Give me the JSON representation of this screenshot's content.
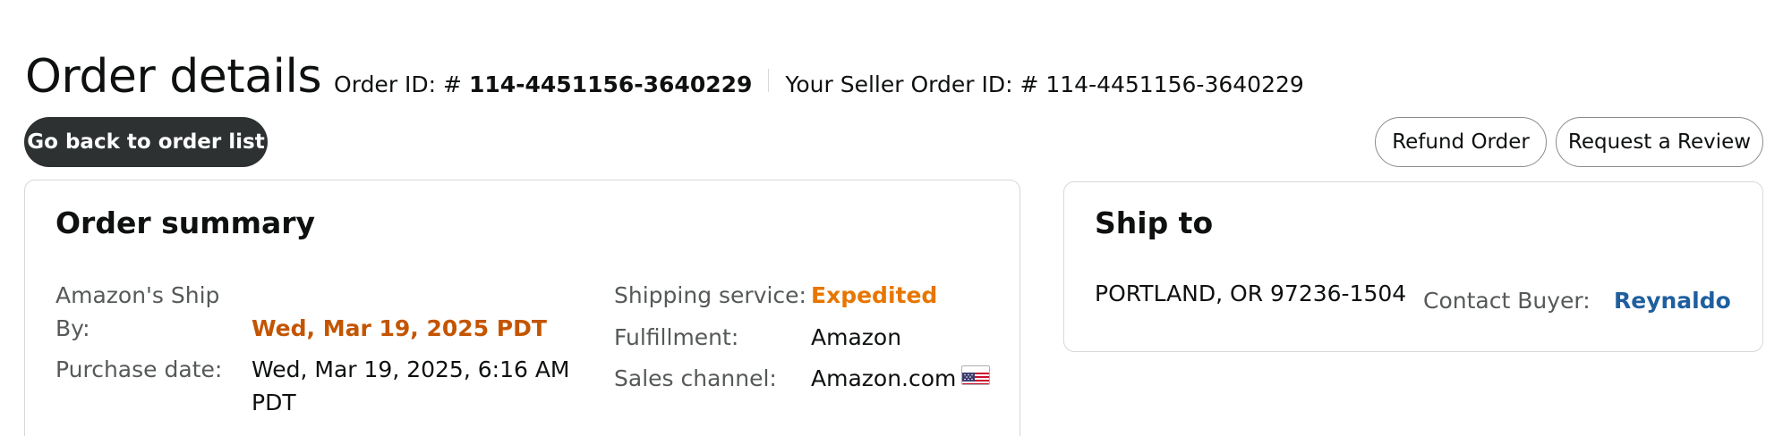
{
  "header": {
    "title": "Order details",
    "order_id_label": "Order ID: # ",
    "order_id": "114-4451156-3640229",
    "seller_order_id": "Your Seller Order ID: # 114-4451156-3640229"
  },
  "actions": {
    "back_label": "Go back to order list",
    "refund_label": "Refund Order",
    "review_label": "Request a Review"
  },
  "order_summary": {
    "title": "Order summary",
    "ship_by_label_line1": "Amazon's Ship",
    "ship_by_label_line2": "By:",
    "ship_by_value": "Wed, Mar 19, 2025 PDT",
    "purchase_date_label": "Purchase date:",
    "purchase_date_line1": "Wed, Mar 19, 2025, 6:16 AM",
    "purchase_date_line2": "PDT",
    "shipping_service_label": "Shipping service:",
    "shipping_service_value": "Expedited",
    "fulfillment_label": "Fulfillment:",
    "fulfillment_value": "Amazon",
    "sales_channel_label": "Sales channel:",
    "sales_channel_value": "Amazon.com",
    "sales_channel_icon": "us-flag-icon"
  },
  "ship_to": {
    "title": "Ship to",
    "address": "PORTLAND, OR 97236-1504",
    "contact_label": "Contact Buyer:",
    "contact_name": "Reynaldo"
  },
  "colors": {
    "dark_button": "#2d3132",
    "ship_by_red": "#c45500",
    "expedited_orange": "#e77600",
    "link_blue": "#1f5f9f"
  }
}
